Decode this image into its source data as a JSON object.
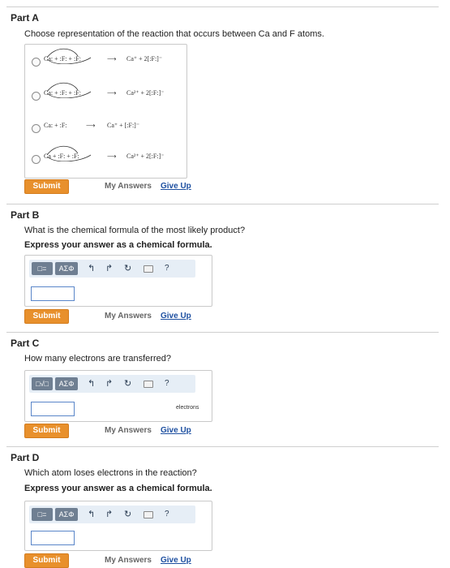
{
  "partA": {
    "title": "Part A",
    "question": "Choose representation of the reaction that occurs between Ca and F atoms.",
    "choices": [
      {
        "reactants": "Ca: + :F: + :F:",
        "arrow": "⟶",
        "products": "Ca⁺ + 2[:F:]⁻"
      },
      {
        "reactants": "Ca: + :F: + :F:",
        "arrow": "⟶",
        "products": "Ca²⁺ + 2[:F:]⁻"
      },
      {
        "reactants": "Ca: + :F:",
        "arrow": "⟶",
        "products": "Ca⁺ + [:F:]⁻"
      },
      {
        "reactants": "Ca + :F: + :F:",
        "arrow": "⟶",
        "products": "Ca²⁺ + 2[:F:]⁻"
      }
    ],
    "submit": "Submit",
    "my_answers": "My Answers",
    "give_up": "Give Up"
  },
  "partB": {
    "title": "Part B",
    "question": "What is the chemical formula of the most likely product?",
    "instruction": "Express your answer as a chemical formula.",
    "toolbar": {
      "template_label": "□=",
      "greek_label": "ΑΣΦ",
      "help": "?"
    },
    "input_value": "",
    "submit": "Submit",
    "my_answers": "My Answers",
    "give_up": "Give Up"
  },
  "partC": {
    "title": "Part C",
    "question": "How many electrons are transferred?",
    "toolbar": {
      "template_label": "□√□",
      "greek_label": "ΑΣΦ",
      "help": "?"
    },
    "input_value": "",
    "unit": "electrons",
    "submit": "Submit",
    "my_answers": "My Answers",
    "give_up": "Give Up"
  },
  "partD": {
    "title": "Part D",
    "question": "Which atom loses electrons in the reaction?",
    "instruction": "Express your answer as a chemical formula.",
    "toolbar": {
      "template_label": "□=",
      "greek_label": "ΑΣΦ",
      "help": "?"
    },
    "input_value": "",
    "submit": "Submit",
    "my_answers": "My Answers",
    "give_up": "Give Up"
  },
  "icons": {
    "undo": "↰",
    "redo": "↱",
    "reset": "↻"
  },
  "colors": {
    "submit": "#e8902c",
    "link": "#1d4fa0",
    "toolbar_bg": "#e6eef6",
    "toolbar_btn": "#6f7f92",
    "input_border": "#5a86c9"
  }
}
